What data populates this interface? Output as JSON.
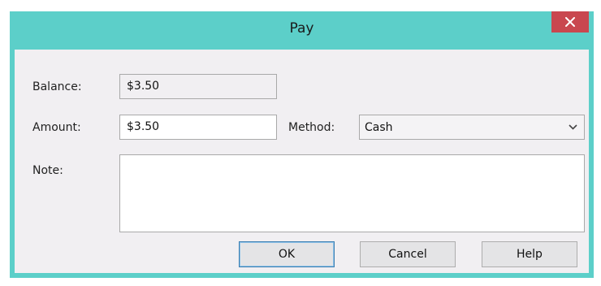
{
  "dialog": {
    "title": "Pay",
    "close_icon": "close-icon"
  },
  "form": {
    "balance_label": "Balance:",
    "balance_value": "$3.50",
    "amount_label": "Amount:",
    "amount_value": "$3.50",
    "method_label": "Method:",
    "method_value": "Cash",
    "note_label": "Note:",
    "note_value": ""
  },
  "buttons": {
    "ok": "OK",
    "cancel": "Cancel",
    "help": "Help"
  },
  "colors": {
    "titlebar": "#5ccfc9",
    "close_button": "#c9474f",
    "client_bg": "#f1eff2"
  }
}
